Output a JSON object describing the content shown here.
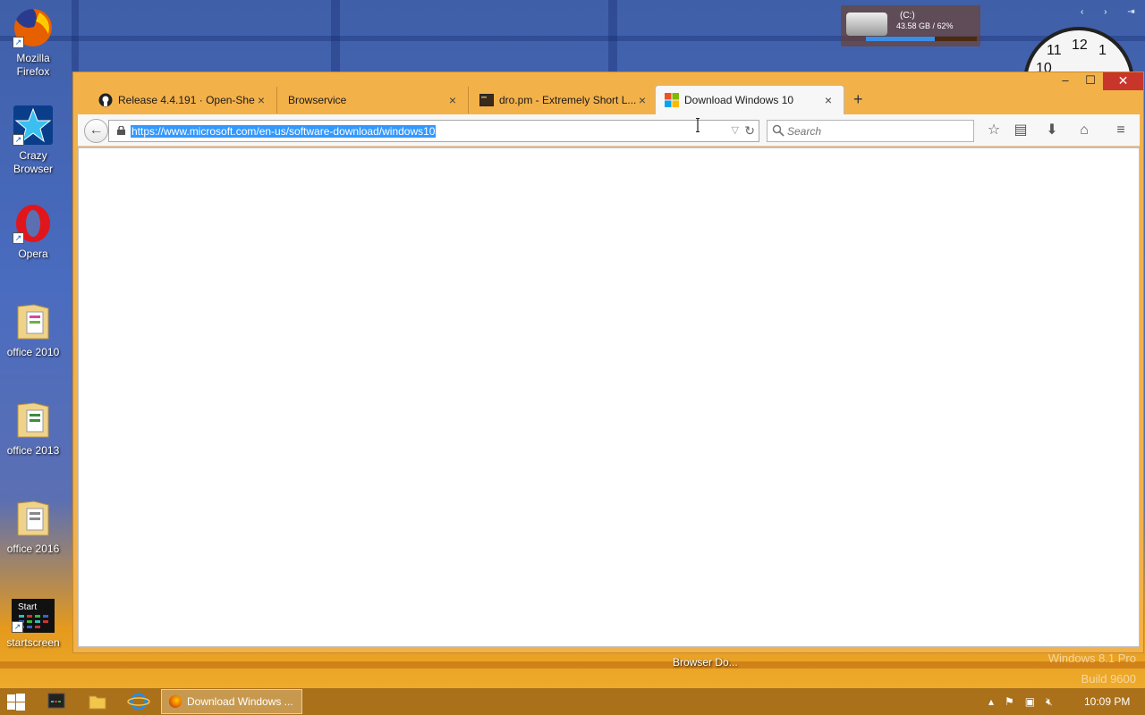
{
  "desktop": {
    "icons": [
      {
        "label": "Mozilla Firefox",
        "icon": "firefox-icon"
      },
      {
        "label": "Crazy Browser",
        "icon": "crazy-browser-icon"
      },
      {
        "label": "Opera",
        "icon": "opera-icon"
      },
      {
        "label": "office 2010",
        "icon": "folder-icon"
      },
      {
        "label": "office 2013",
        "icon": "folder-icon"
      },
      {
        "label": "office 2016",
        "icon": "folder-icon"
      },
      {
        "label": "startscreen",
        "icon": "startscreen-icon",
        "overlay_text": "Start"
      }
    ],
    "drive_gadget": {
      "drive": "(C:)",
      "usage": "43.58 GB / 62%",
      "percent": 62
    },
    "clock_gadget": {
      "numbers": [
        "11",
        "12",
        "1",
        "10"
      ]
    },
    "background_shortcut_text": "Browser Do...",
    "watermark": {
      "line1": "Windows 8.1 Pro",
      "line2": "Build 9600"
    }
  },
  "browser": {
    "window_controls": {
      "minimize": "–",
      "maximize": "☐",
      "close": "✕"
    },
    "tabs": [
      {
        "title": "Release 4.4.191 · Open-Shel...",
        "favicon": "github-icon",
        "active": false
      },
      {
        "title": "Browservice",
        "favicon": "",
        "active": false
      },
      {
        "title": "dro.pm - Extremely Short L...",
        "favicon": "terminal-icon",
        "active": false
      },
      {
        "title": "Download Windows 10",
        "favicon": "microsoft-icon",
        "active": true
      }
    ],
    "new_tab_label": "+",
    "url": "https://www.microsoft.com/en-us/software-download/windows10",
    "search_placeholder": "Search",
    "toolbar": [
      "star-icon",
      "reading-list-icon",
      "download-icon",
      "home-icon",
      "menu-icon"
    ]
  },
  "taskbar": {
    "pinned": [
      "start-button",
      "start-app-icon",
      "file-explorer-icon",
      "internet-explorer-icon"
    ],
    "task_label": "Download Windows ...",
    "tray_icons": [
      "show-hidden-icons",
      "action-center-icon",
      "network-icon",
      "volume-muted-icon"
    ],
    "time": "10:09 PM"
  }
}
